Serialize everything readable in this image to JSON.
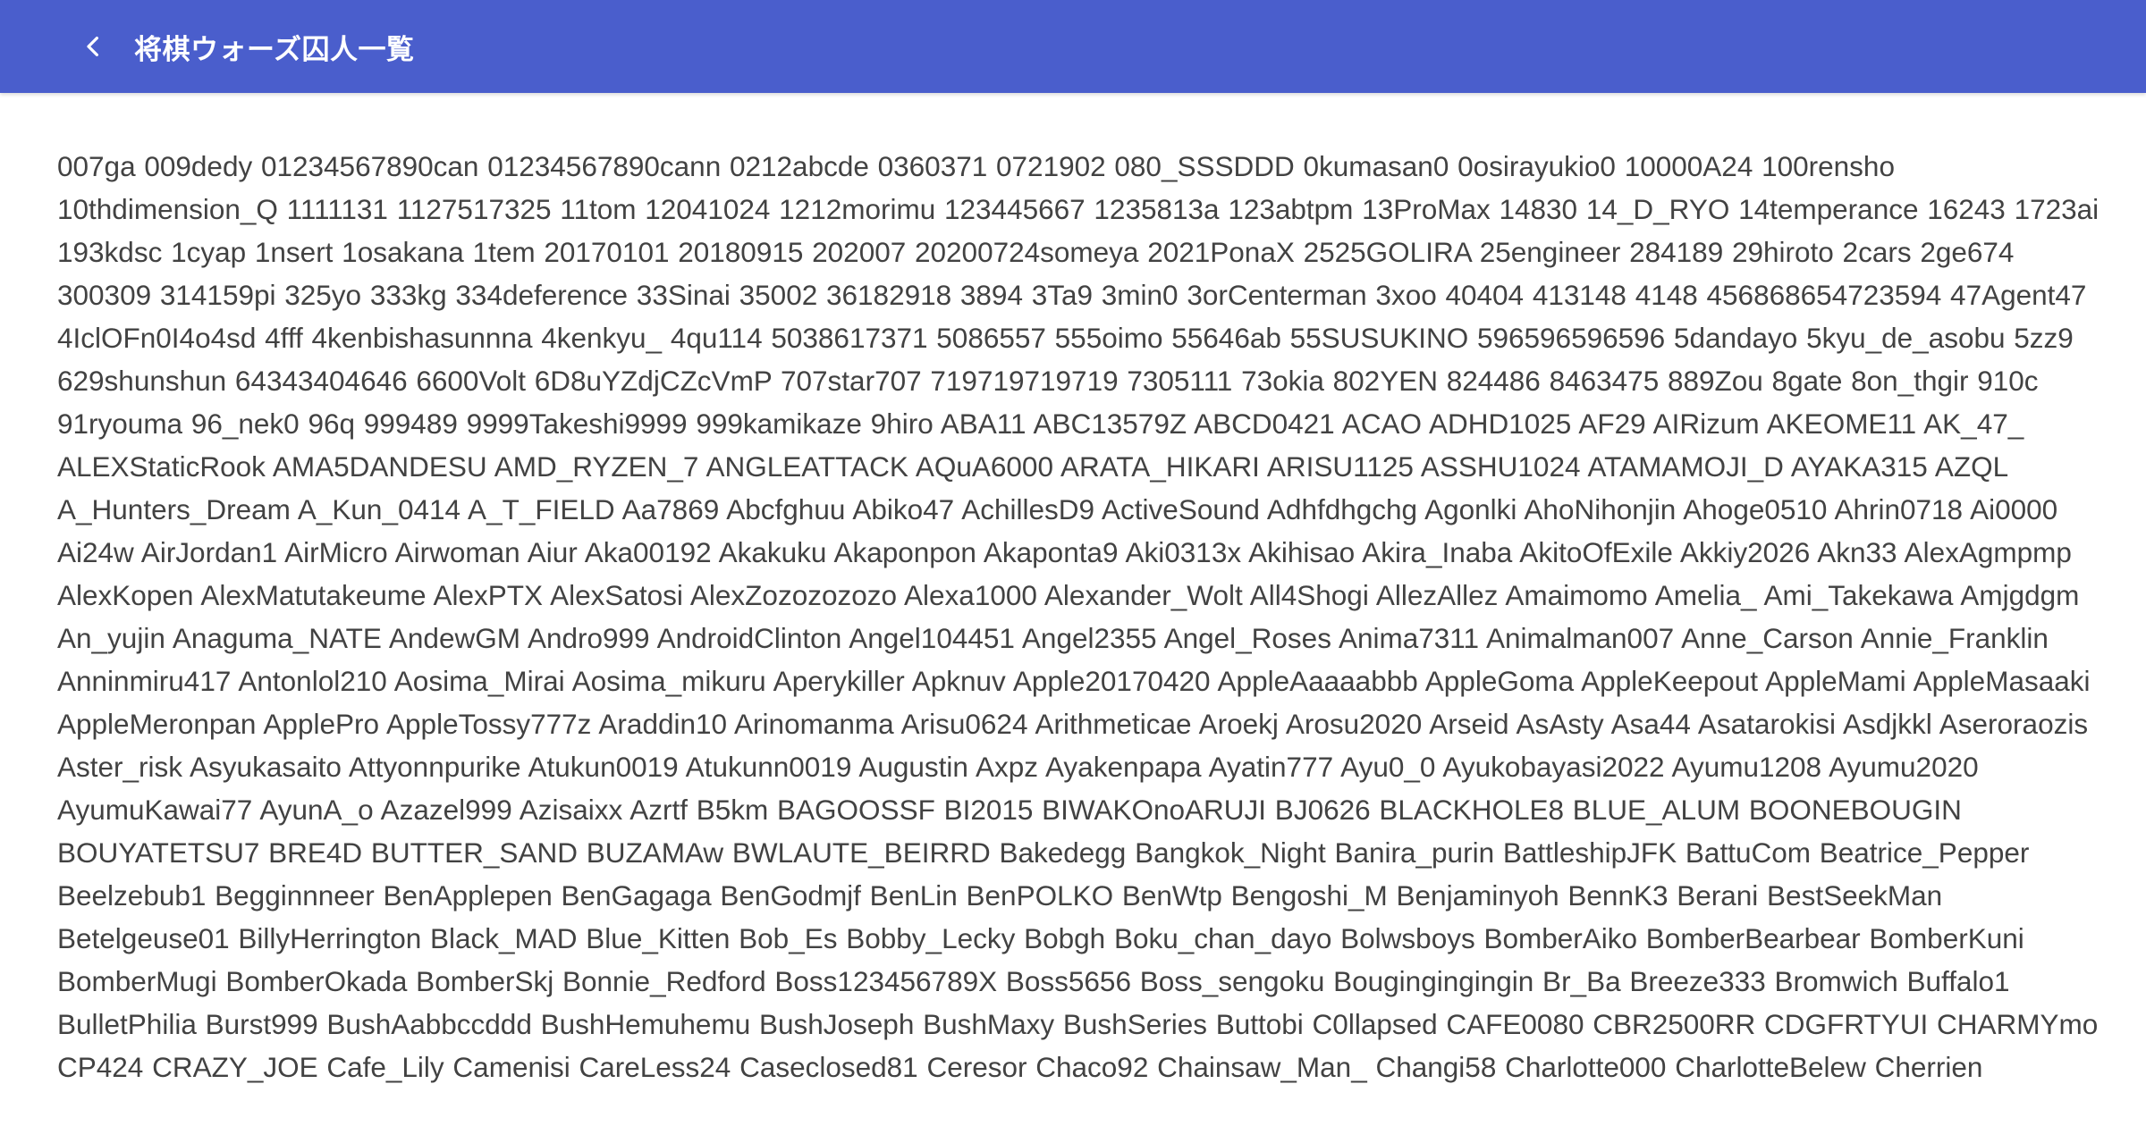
{
  "app_bar": {
    "back_icon": "chevron-left-icon",
    "title": "将棋ウォーズ囚人一覧",
    "color": "#4a5ecc"
  },
  "prisoner_list": "007ga 009dedy 01234567890can 01234567890cann 0212abcde 0360371 0721902 080_SSSDDD 0kumasan0 0osirayukio0 10000A24 100rensho 10thdimension_Q 1111131 1127517325 11tom 12041024 1212morimu 123445667 1235813a 123abtpm 13ProMax 14830 14_D_RYO 14temperance 16243 1723ai 193kdsc 1cyap 1nsert 1osakana 1tem 20170101 20180915 202007 20200724someya 2021PonaX 2525GOLIRA 25engineer 284189 29hiroto 2cars 2ge674 300309 314159pi 325yo 333kg 334deference 33Sinai 35002 36182918 3894 3Ta9 3min0 3orCenterman 3xoo 40404 413148 4148 456868654723594 47Agent47 4IclOFn0I4o4sd 4fff 4kenbishasunnna 4kenkyu_ 4qu114 5038617371 5086557 555oimo 55646ab 55SUSUKINO 596596596596 5dandayo 5kyu_de_asobu 5zz9 629shunshun 64343404646 6600Volt 6D8uYZdjCZcVmP 707star707 719719719719 7305111 73okia 802YEN 824486 8463475 889Zou 8gate 8on_thgir 910c 91ryouma 96_nek0 96q 999489 9999Takeshi9999 999kamikaze 9hiro ABA11 ABC13579Z ABCD0421 ACAO ADHD1025 AF29 AIRizum AKEOME11 AK_47_ ALEXStaticRook AMA5DANDESU AMD_RYZEN_7 ANGLEATTACK AQuA6000 ARATA_HIKARI ARISU1125 ASSHU1024 ATAMAMOJI_D AYAKA315 AZQL A_Hunters_Dream A_Kun_0414 A_T_FIELD Aa7869 Abcfghuu Abiko47 AchillesD9 ActiveSound Adhfdhgchg Agonlki AhoNihonjin Ahoge0510 Ahrin0718 Ai0000 Ai24w AirJordan1 AirMicro Airwoman Aiur Aka00192 Akakuku Akaponpon Akaponta9 Aki0313x Akihisao Akira_Inaba AkitoOfExile Akkiy2026 Akn33 AlexAgmpmp AlexKopen AlexMatutakeume AlexPTX AlexSatosi AlexZozozozozo Alexa1000 Alexander_Wolt All4Shogi AllezAllez Amaimomo Amelia_ Ami_Takekawa Amjgdgm An_yujin Anaguma_NATE AndewGM Andro999 AndroidClinton Angel104451 Angel2355 Angel_Roses Anima7311 Animalman007 Anne_Carson Annie_Franklin Anninmiru417 Antonlol210 Aosima_Mirai Aosima_mikuru Aperykiller Apknuv Apple20170420 AppleAaaaabbb AppleGoma AppleKeepout AppleMami AppleMasaaki AppleMeronpan ApplePro AppleTossy777z Araddin10 Arinomanma Arisu0624 Arithmeticae Aroekj Arosu2020 Arseid AsAsty Asa44 Asatarokisi Asdjkkl Aseroraozis Aster_risk Asyukasaito Attyonnpurike Atukun0019 Atukunn0019 Augustin Axpz Ayakenpapa Ayatin777 Ayu0_0 Ayukobayasi2022 Ayumu1208 Ayumu2020 AyumuKawai77 AyunA_o Azazel999 Azisaixx Azrtf B5km BAGOOSSF BI2015 BIWAKOnoARUJI BJ0626 BLACKHOLE8 BLUE_ALUM BOONEBOUGIN BOUYATETSU7 BRE4D BUTTER_SAND BUZAMAw BWLAUTE_BEIRRD Bakedegg Bangkok_Night Banira_purin BattleshipJFK BattuCom Beatrice_Pepper Beelzebub1 Begginnneer BenApplepen BenGagaga BenGodmjf BenLin BenPOLKO BenWtp Bengoshi_M Benjaminyoh BennK3 Berani BestSeekMan Betelgeuse01 BillyHerrington Black_MAD Blue_Kitten Bob_Es Bobby_Lecky Bobgh Boku_chan_dayo Bolwsboys BomberAiko BomberBearbear BomberKuni BomberMugi BomberOkada BomberSkj Bonnie_Redford Boss123456789X Boss5656 Boss_sengoku Bougingingingin Br_Ba Breeze333 Bromwich Buffalo1 BulletPhilia Burst999 BushAabbccddd BushHemuhemu BushJoseph BushMaxy BushSeries Buttobi C0llapsed CAFE0080 CBR2500RR CDGFRTYUI CHARMYmo CP424 CRAZY_JOE Cafe_Lily Camenisi CareLess24 Caseclosed81 Ceresor Chaco92 Chainsaw_Man_ Changi58 Charlotte000 CharlotteBelew Cherrien"
}
